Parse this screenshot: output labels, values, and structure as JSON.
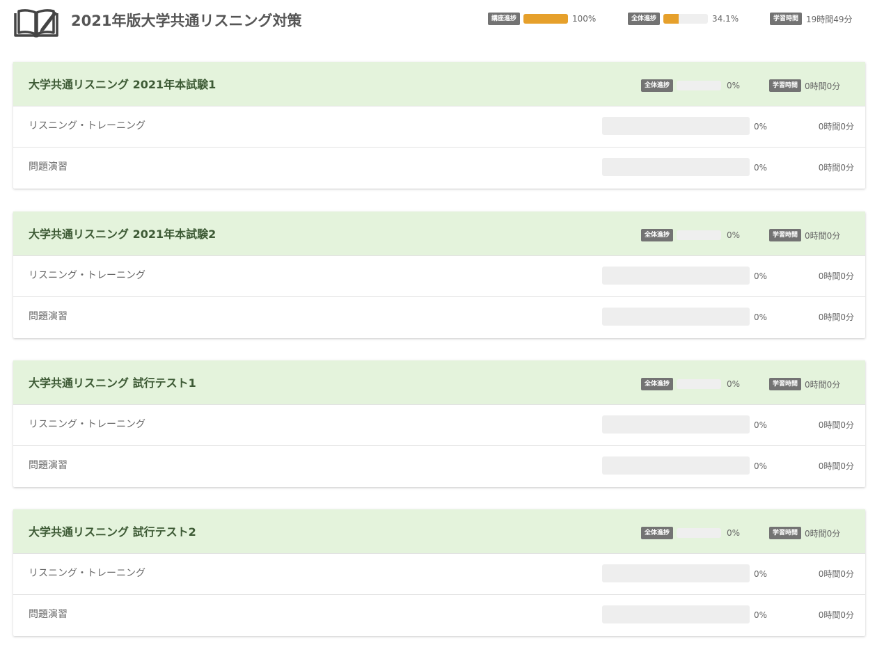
{
  "app": {
    "title": "2021年版大学共通リスニング対策",
    "icon": "open-book-pen-icon"
  },
  "header_stats": {
    "lecture_progress": {
      "label": "講座進捗",
      "value": "100%",
      "fraction": 1.0
    },
    "overall_progress": {
      "label": "全体進捗",
      "value": "34.1%",
      "fraction": 0.341
    },
    "study_time": {
      "label": "学習時間",
      "value": "19時間49分"
    }
  },
  "colors": {
    "accent": "#e6a02b",
    "section_header_bg": "#e4f3dc",
    "badge_bg": "#737373"
  },
  "sections": [
    {
      "title": "大学共通リスニング 2021年本試験1",
      "progress_label": "全体進捗",
      "progress": "0%",
      "progress_fraction": 0,
      "time_label": "学習時間",
      "time": "0時間0分",
      "items": [
        {
          "label": "リスニング・トレーニング",
          "progress": "0%",
          "progress_fraction": 0,
          "time": "0時間0分"
        },
        {
          "label": "問題演習",
          "progress": "0%",
          "progress_fraction": 0,
          "time": "0時間0分"
        }
      ]
    },
    {
      "title": "大学共通リスニング 2021年本試験2",
      "progress_label": "全体進捗",
      "progress": "0%",
      "progress_fraction": 0,
      "time_label": "学習時間",
      "time": "0時間0分",
      "items": [
        {
          "label": "リスニング・トレーニング",
          "progress": "0%",
          "progress_fraction": 0,
          "time": "0時間0分"
        },
        {
          "label": "問題演習",
          "progress": "0%",
          "progress_fraction": 0,
          "time": "0時間0分"
        }
      ]
    },
    {
      "title": "大学共通リスニング 試行テスト1",
      "progress_label": "全体進捗",
      "progress": "0%",
      "progress_fraction": 0,
      "time_label": "学習時間",
      "time": "0時間0分",
      "items": [
        {
          "label": "リスニング・トレーニング",
          "progress": "0%",
          "progress_fraction": 0,
          "time": "0時間0分"
        },
        {
          "label": "問題演習",
          "progress": "0%",
          "progress_fraction": 0,
          "time": "0時間0分"
        }
      ]
    },
    {
      "title": "大学共通リスニング 試行テスト2",
      "progress_label": "全体進捗",
      "progress": "0%",
      "progress_fraction": 0,
      "time_label": "学習時間",
      "time": "0時間0分",
      "items": [
        {
          "label": "リスニング・トレーニング",
          "progress": "0%",
          "progress_fraction": 0,
          "time": "0時間0分"
        },
        {
          "label": "問題演習",
          "progress": "0%",
          "progress_fraction": 0,
          "time": "0時間0分"
        }
      ]
    }
  ]
}
